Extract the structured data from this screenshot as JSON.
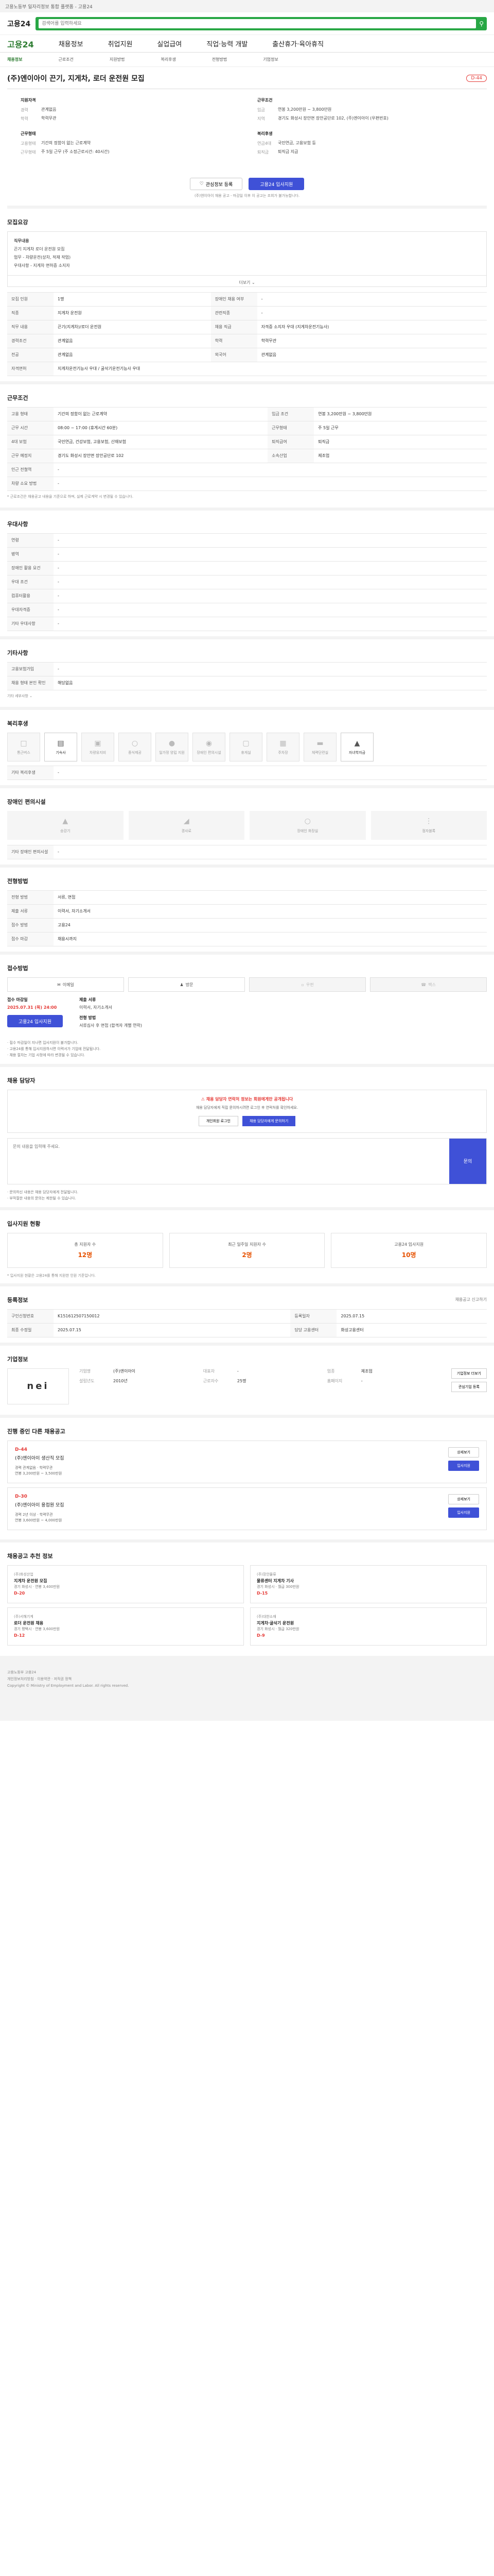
{
  "topbar": {
    "text": "고용노동부 일자리정보 통합 플랫폼 - 고용24"
  },
  "header": {
    "logo": "고용24",
    "search_placeholder": "검색어를 입력하세요"
  },
  "nav": {
    "brand": "고용24",
    "items": [
      "채용정보",
      "취업지원",
      "실업급여",
      "직업·능력 개발",
      "출산휴가·육아휴직"
    ]
  },
  "subnav": {
    "items": [
      "채용정보",
      "근로조건",
      "지원방법",
      "복리후생",
      "전형방법",
      "기업정보"
    ],
    "active_index": 0
  },
  "job": {
    "title": "(주)엔이아이 끈기, 지게차, 로더 운전원 모집",
    "dday": "D-44"
  },
  "summary": {
    "left_head": "지원자격",
    "left_rows": [
      {
        "k": "경력",
        "v": "관계없음"
      },
      {
        "k": "학력",
        "v": "학력무관"
      }
    ],
    "left2_head": "근무형태",
    "left2_rows": [
      {
        "k": "고용형태",
        "v": "기간의 정함이 없는 근로계약"
      },
      {
        "k": "근무형태",
        "v": "주 5일 근무 (주 소정근로시간: 40시간)"
      }
    ],
    "right_head": "근무조건",
    "right_rows": [
      {
        "k": "임금",
        "v": "연봉 3,200만원 ~ 3,800만원"
      },
      {
        "k": "지역",
        "v": "경기도 화성시 장안면 장안공단로 102, (주)엔이아이 (우편번호)"
      }
    ],
    "right2_head": "복리후생",
    "right2_rows": [
      {
        "k": "연금4대",
        "v": "국민연금, 고용보험 등"
      },
      {
        "k": "퇴직금",
        "v": "퇴직금 지급"
      }
    ]
  },
  "actions": {
    "favorite": "관심정보 등록",
    "apply": "고용24 입사지원",
    "note": "(주)엔이아이 채용 공고 - 마감일 이후 이 공고는 조회가 불가능합니다."
  },
  "duties": {
    "title": "모집요강",
    "box_title": "직무내용",
    "lines": [
      "끈기 지게차 로더 운전원 모집",
      "업무 - 차량운전(상차, 적재 작업)",
      "우대사항 - 지게차 면허증 소지자"
    ],
    "more": "더보기"
  },
  "recruit_table": {
    "rows": [
      {
        "k": "모집 인원",
        "v": "1명",
        "k2": "장애인 채용 여부",
        "v2": "-"
      },
      {
        "k": "직종",
        "v": "지게차 운전원",
        "k2": "관련직종",
        "v2": "-"
      },
      {
        "k": "직무 내용",
        "v": "끈기(지게차)/로더 운전원",
        "k2": "채용 직급",
        "v2": "자격증 소지자 우대 (지게차운전기능사)"
      },
      {
        "k": "경력조건",
        "v": "관계없음",
        "k2": "학력",
        "v2": "학력무관"
      },
      {
        "k": "전공",
        "v": "관계없음",
        "k2": "외국어",
        "v2": "관계없음"
      },
      {
        "k": "자격면허",
        "v": "지게차운전기능사 우대 / 굴삭기운전기능사 우대",
        "k2": "",
        "v2": ""
      }
    ]
  },
  "conditions": {
    "title": "근무조건",
    "rows": [
      {
        "k": "고용 형태",
        "v": "기간의 정함이 없는 근로계약",
        "k2": "임금 조건",
        "v2": "연봉 3,200만원 ~ 3,800만원"
      },
      {
        "k": "근무 시간",
        "v": "08:00 ~ 17:00 (휴게시간 60분)",
        "k2": "근무형태",
        "v2": "주 5일 근무"
      },
      {
        "k": "4대 보험",
        "v": "국민연금, 건강보험, 고용보험, 산재보험",
        "k2": "퇴직급여",
        "v2": "퇴직금"
      },
      {
        "k": "근무 예정지",
        "v": "경기도 화성시 장안면 장안공단로 102",
        "k2": "소속산업",
        "v2": "제조업"
      },
      {
        "k": "인근 전철역",
        "v": "-",
        "k2": "",
        "v2": ""
      },
      {
        "k": "차량 소요 방법",
        "v": "-",
        "k2": "",
        "v2": ""
      }
    ],
    "note": "* 근로조건은 채용공고 내용을 기준으로 하며, 실제 근로계약 시 변경될 수 있습니다."
  },
  "qualify": {
    "title": "우대사항",
    "rows": [
      {
        "k": "연령",
        "v": "-"
      },
      {
        "k": "병역",
        "v": "-"
      },
      {
        "k": "장애인 활용 요건",
        "v": "-"
      },
      {
        "k": "우대 조건",
        "v": "-"
      },
      {
        "k": "컴퓨터활용",
        "v": "-"
      },
      {
        "k": "우대자격증",
        "v": "-"
      },
      {
        "k": "기타 우대사항",
        "v": "-"
      }
    ]
  },
  "other_info": {
    "title": "기타사항",
    "rows": [
      {
        "k": "고용보험가입",
        "v": "-"
      },
      {
        "k": "채용 형태 본인 확인",
        "v": "해당없음"
      }
    ],
    "more": "기타 세부사항"
  },
  "welfare": {
    "title": "복리후생",
    "items": [
      {
        "label": "통근버스",
        "icon": "bus-icon",
        "on": false
      },
      {
        "label": "기숙사",
        "icon": "bed-icon",
        "on": true
      },
      {
        "label": "차량유지비",
        "icon": "car-icon",
        "on": false
      },
      {
        "label": "중식제공",
        "icon": "meal-icon",
        "on": false
      },
      {
        "label": "일가정 양립 지원",
        "icon": "family-icon",
        "on": false
      },
      {
        "label": "장애인 편의시설",
        "icon": "access-icon",
        "on": false
      },
      {
        "label": "휴게실",
        "icon": "lounge-icon",
        "on": false
      },
      {
        "label": "주차장",
        "icon": "parking-icon",
        "on": false
      },
      {
        "label": "체력단련실",
        "icon": "gym-icon",
        "on": false
      },
      {
        "label": "자녀학자금",
        "icon": "school-icon",
        "on": true
      }
    ],
    "extra_k": "기타 복리후생",
    "extra_v": "-"
  },
  "disability": {
    "title": "장애인 편의시설",
    "items": [
      "승강기",
      "경사로",
      "장애인 화장실",
      "점자블록"
    ],
    "extra_k": "기타 장애인 편의시설",
    "extra_v": "-"
  },
  "selection": {
    "title": "전형방법",
    "rows": [
      {
        "k": "전형 방법",
        "v": "서류, 면접"
      },
      {
        "k": "제출 서류",
        "v": "이력서, 자기소개서"
      },
      {
        "k": "접수 방법",
        "v": "고용24"
      },
      {
        "k": "접수 마감",
        "v": "채용시까지"
      }
    ]
  },
  "method": {
    "title": "접수방법",
    "chips": [
      {
        "label": "이메일",
        "on": true
      },
      {
        "label": "방문",
        "on": true
      },
      {
        "label": "우편",
        "on": false
      },
      {
        "label": "팩스",
        "on": false
      }
    ],
    "apply_k": "접수 마감일",
    "apply_v": "2025.07.31 (목) 24:00",
    "apply_btn": "고용24 입사지원",
    "doc_k": "제출 서류",
    "doc_v": "이력서, 자기소개서",
    "proc_k": "전형 방법",
    "proc_v": "서류심사 후 면접 (합격자 개별 연락)",
    "notices": [
      "· 접수 마감일이 지나면 입사지원이 불가합니다.",
      "· 고용24를 통해 입사지원하시면 이력서가 기업에 전달됩니다.",
      "· 채용 절차는 기업 사정에 따라 변경될 수 있습니다."
    ]
  },
  "contact": {
    "title": "채용 담당자",
    "warn": "채용 담당자 연락처 정보는 회원에게만 공개됩니다",
    "text": "채용 담당자에게 직접 문의하시려면 로그인 후 연락처를 확인하세요.",
    "btn_login": "개인회원 로그인",
    "btn_contact": "채용 담당자에게 문의하기",
    "q_placeholder": "문의 내용을 입력해 주세요.",
    "q_btn": "문의",
    "notes": [
      "· 문의하신 내용은 채용 담당자에게 전달됩니다.",
      "· 부적절한 내용의 문의는 제한될 수 있습니다."
    ]
  },
  "stats": {
    "title": "입사지원 현황",
    "items": [
      {
        "k": "총 지원자 수",
        "v": "12명"
      },
      {
        "k": "최근 일주일 지원자 수",
        "v": "2명"
      },
      {
        "k": "고용24 입사지원",
        "v": "10명"
      }
    ],
    "note": "* 입사지원 현황은 고용24를 통해 지원한 인원 기준입니다."
  },
  "registration": {
    "title": "등록정보",
    "rows": [
      {
        "k": "구인신청번호",
        "v": "K151612507150012",
        "k2": "등록일자",
        "v2": "2025.07.15"
      },
      {
        "k": "최종 수정일",
        "v": "2025.07.15",
        "k2": "담당 고용센터",
        "v2": "화성고용센터"
      }
    ],
    "aside": "채용공고 신고하기"
  },
  "company": {
    "title": "기업정보",
    "logo_a": "nei",
    "logo_b": "",
    "rows": [
      {
        "k": "기업명",
        "v": "(주)엔이아이"
      },
      {
        "k": "대표자",
        "v": "-"
      },
      {
        "k": "업종",
        "v": "제조업"
      },
      {
        "k": "설립년도",
        "v": "2010년"
      },
      {
        "k": "근로자수",
        "v": "25명"
      },
      {
        "k": "홈페이지",
        "v": "-"
      }
    ],
    "btns": [
      "기업정보 더보기",
      "관심기업 등록"
    ]
  },
  "other_jobs": {
    "title": "진행 중인 다른 채용공고",
    "items": [
      {
        "dday": "D-44",
        "title": "(주)엔이아이 생산직 모집",
        "lines": [
          "경력 관계없음 · 학력무관",
          "연봉 3,200만원 ~ 3,500만원"
        ]
      },
      {
        "dday": "D-30",
        "title": "(주)엔이아이 용접원 모집",
        "lines": [
          "경력 2년 이상 · 학력무관",
          "연봉 3,600만원 ~ 4,000만원"
        ]
      }
    ],
    "btn_view": "상세보기",
    "btn_apply": "입사지원"
  },
  "similar": {
    "title": "채용공고 추천 정보",
    "items": [
      {
        "co": "(주)화성산업",
        "title": "지게차 운전원 모집",
        "meta": "경기 화성시 · 연봉 3,400만원",
        "dd": "D-20"
      },
      {
        "co": "(주)장안물류",
        "title": "물류센터 지게차 기사",
        "meta": "경기 화성시 · 월급 300만원",
        "dd": "D-15"
      },
      {
        "co": "(주)서해기계",
        "title": "로더 운전원 채용",
        "meta": "경기 평택시 · 연봉 3,600만원",
        "dd": "D-12"
      },
      {
        "co": "(주)대한소재",
        "title": "지게차·굴삭기 운전원",
        "meta": "경기 화성시 · 월급 320만원",
        "dd": "D-9"
      }
    ]
  },
  "footer": {
    "lines": [
      "고용노동부 고용24",
      "개인정보처리방침 · 이용약관 · 저작권 정책",
      "Copyright © Ministry of Employment and Labor. All rights reserved."
    ]
  }
}
